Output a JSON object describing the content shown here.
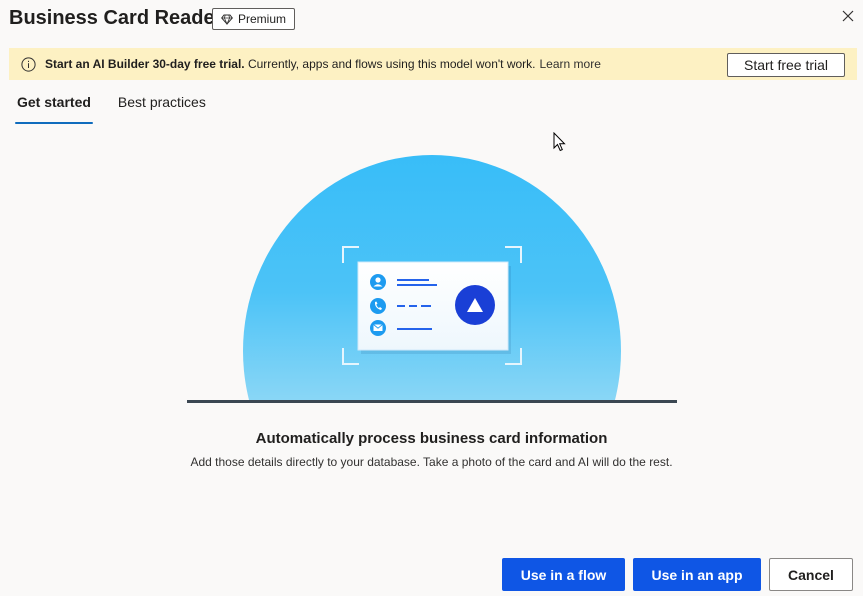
{
  "dialog": {
    "title": "Business Card Reader",
    "badge": "Premium",
    "close_icon": "close-icon"
  },
  "banner": {
    "icon": "info-icon",
    "bold_text": "Start an AI Builder 30-day free trial.",
    "text": "Currently, apps and flows using this model won't work.",
    "link": "Learn more",
    "button": "Start free trial",
    "background": "#fdf1c3"
  },
  "tabs": [
    {
      "label": "Get started",
      "selected": true
    },
    {
      "label": "Best practices",
      "selected": false
    }
  ],
  "main": {
    "headline": "Automatically process business card information",
    "description": "Add those details directly to your database. Take a photo of the card and AI will do the rest."
  },
  "footer": {
    "use_in_flow": "Use in a flow",
    "use_in_app": "Use in an app",
    "cancel": "Cancel"
  },
  "colors": {
    "accent": "#0f56e5",
    "tab_indicator": "#0f6cbd",
    "illustration_sky": "#38bdf8"
  }
}
